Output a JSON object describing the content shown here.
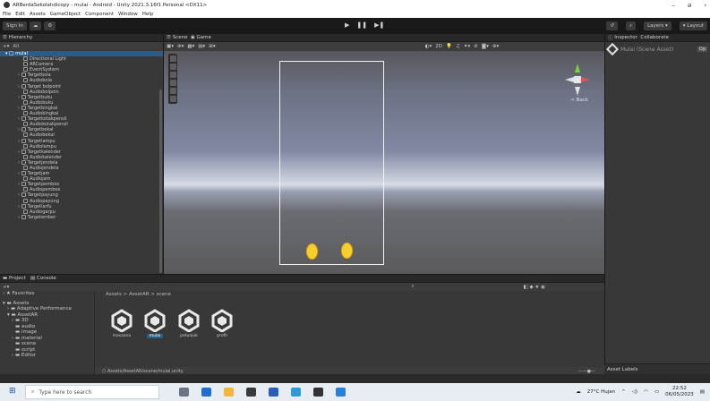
{
  "window": {
    "title": "ARBerdaSekolahdicopy - mulai - Android - Unity 2021.3.16f1 Personal <DX11>"
  },
  "menu": [
    "File",
    "Edit",
    "Assets",
    "GameObject",
    "Component",
    "Window",
    "Help"
  ],
  "toolbar": {
    "sign_in": "Sign In",
    "layers": "Layers",
    "layout": "Layout"
  },
  "hierarchy": {
    "tab": "Hierarchy",
    "search_placeholder": "All",
    "root": "mulai",
    "items": [
      "Directional Light",
      "ARCamera",
      "EventSystem",
      "Targetbola",
      "Audiobola",
      "Target bolpoint",
      "Audiobolpoin",
      "Targetbuku",
      "Audiobuku",
      "Targetbingkai",
      "Audiobingkai",
      "Targetkotakpensil",
      "Audiokotakpensil",
      "Targetbekal",
      "Audiobekal",
      "Targetlampu",
      "Audiolampu",
      "Targetkalender",
      "Audiokalender",
      "Targetjendela",
      "Audiojendela",
      "Targetjam",
      "Audiojam",
      "Targetpembox",
      "Audiopembox",
      "Targetpayung",
      "Audiopayung",
      "Targetlarfu",
      "Audiogarpu",
      "Targetember"
    ]
  },
  "scene": {
    "tab_scene": "Scene",
    "tab_game": "Game",
    "persp_label": "< Back"
  },
  "inspector": {
    "tab": "Inspector",
    "tab2": "Collaborate",
    "object": "Mulai (Scene Asset)",
    "open_label": "Op"
  },
  "project": {
    "tab": "Project",
    "tab2": "Console",
    "favorites": "Favorites",
    "tree": [
      "Assets",
      "Adaptive Performance",
      "AssetAR",
      "3D",
      "audio",
      "image",
      "material",
      "scene",
      "script",
      "Editor"
    ],
    "breadcrumb": "Assets > AssetAR > scene",
    "assets": [
      {
        "name": "masaanu",
        "selected": false
      },
      {
        "name": "mulai",
        "selected": true
      },
      {
        "name": "petunjuk",
        "selected": false
      },
      {
        "name": "profil",
        "selected": false
      }
    ],
    "path": "Assets/AssetAR/scene/mulai.unity"
  },
  "asset_labels": "Asset Labels",
  "taskbar": {
    "search_placeholder": "Type here to search",
    "weather": "27°C Hujan",
    "time": "22:52",
    "date": "06/05/2023"
  }
}
